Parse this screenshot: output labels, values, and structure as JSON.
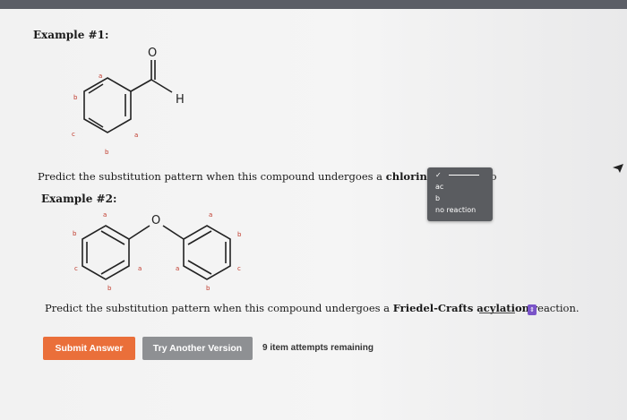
{
  "example1": {
    "heading": "Example #1:",
    "molecule": {
      "carbonyl_o": "O",
      "hydrogen": "H",
      "labels": [
        "a",
        "b",
        "a",
        "c",
        "b"
      ]
    },
    "question_before": "Predict the substitution pattern when this compound undergoes a ",
    "question_bold": "chlorination",
    "question_after": " reactio",
    "selected_mark": "✓"
  },
  "dropdown": {
    "options": [
      "",
      "ac",
      "b",
      "no reaction"
    ]
  },
  "example2": {
    "heading": "Example #2:",
    "molecule": {
      "oxygen": "O",
      "labels": [
        "a",
        "b",
        "c",
        "a",
        "b",
        "a",
        "b",
        "a",
        "c",
        "b"
      ]
    },
    "question_before": "Predict the substitution pattern when this compound undergoes a ",
    "question_bold": "Friedel-Crafts acylation",
    "question_after": " reaction."
  },
  "stepper_icon": "updown-arrows-icon",
  "buttons": {
    "submit": "Submit Answer",
    "try_another": "Try Another Version"
  },
  "attempts_text": "9 item attempts remaining",
  "colors": {
    "submit": "#ea6f3a",
    "try_another": "#8e9093",
    "dropdown_bg": "#5a5c60",
    "stepper": "#7a54c8"
  }
}
